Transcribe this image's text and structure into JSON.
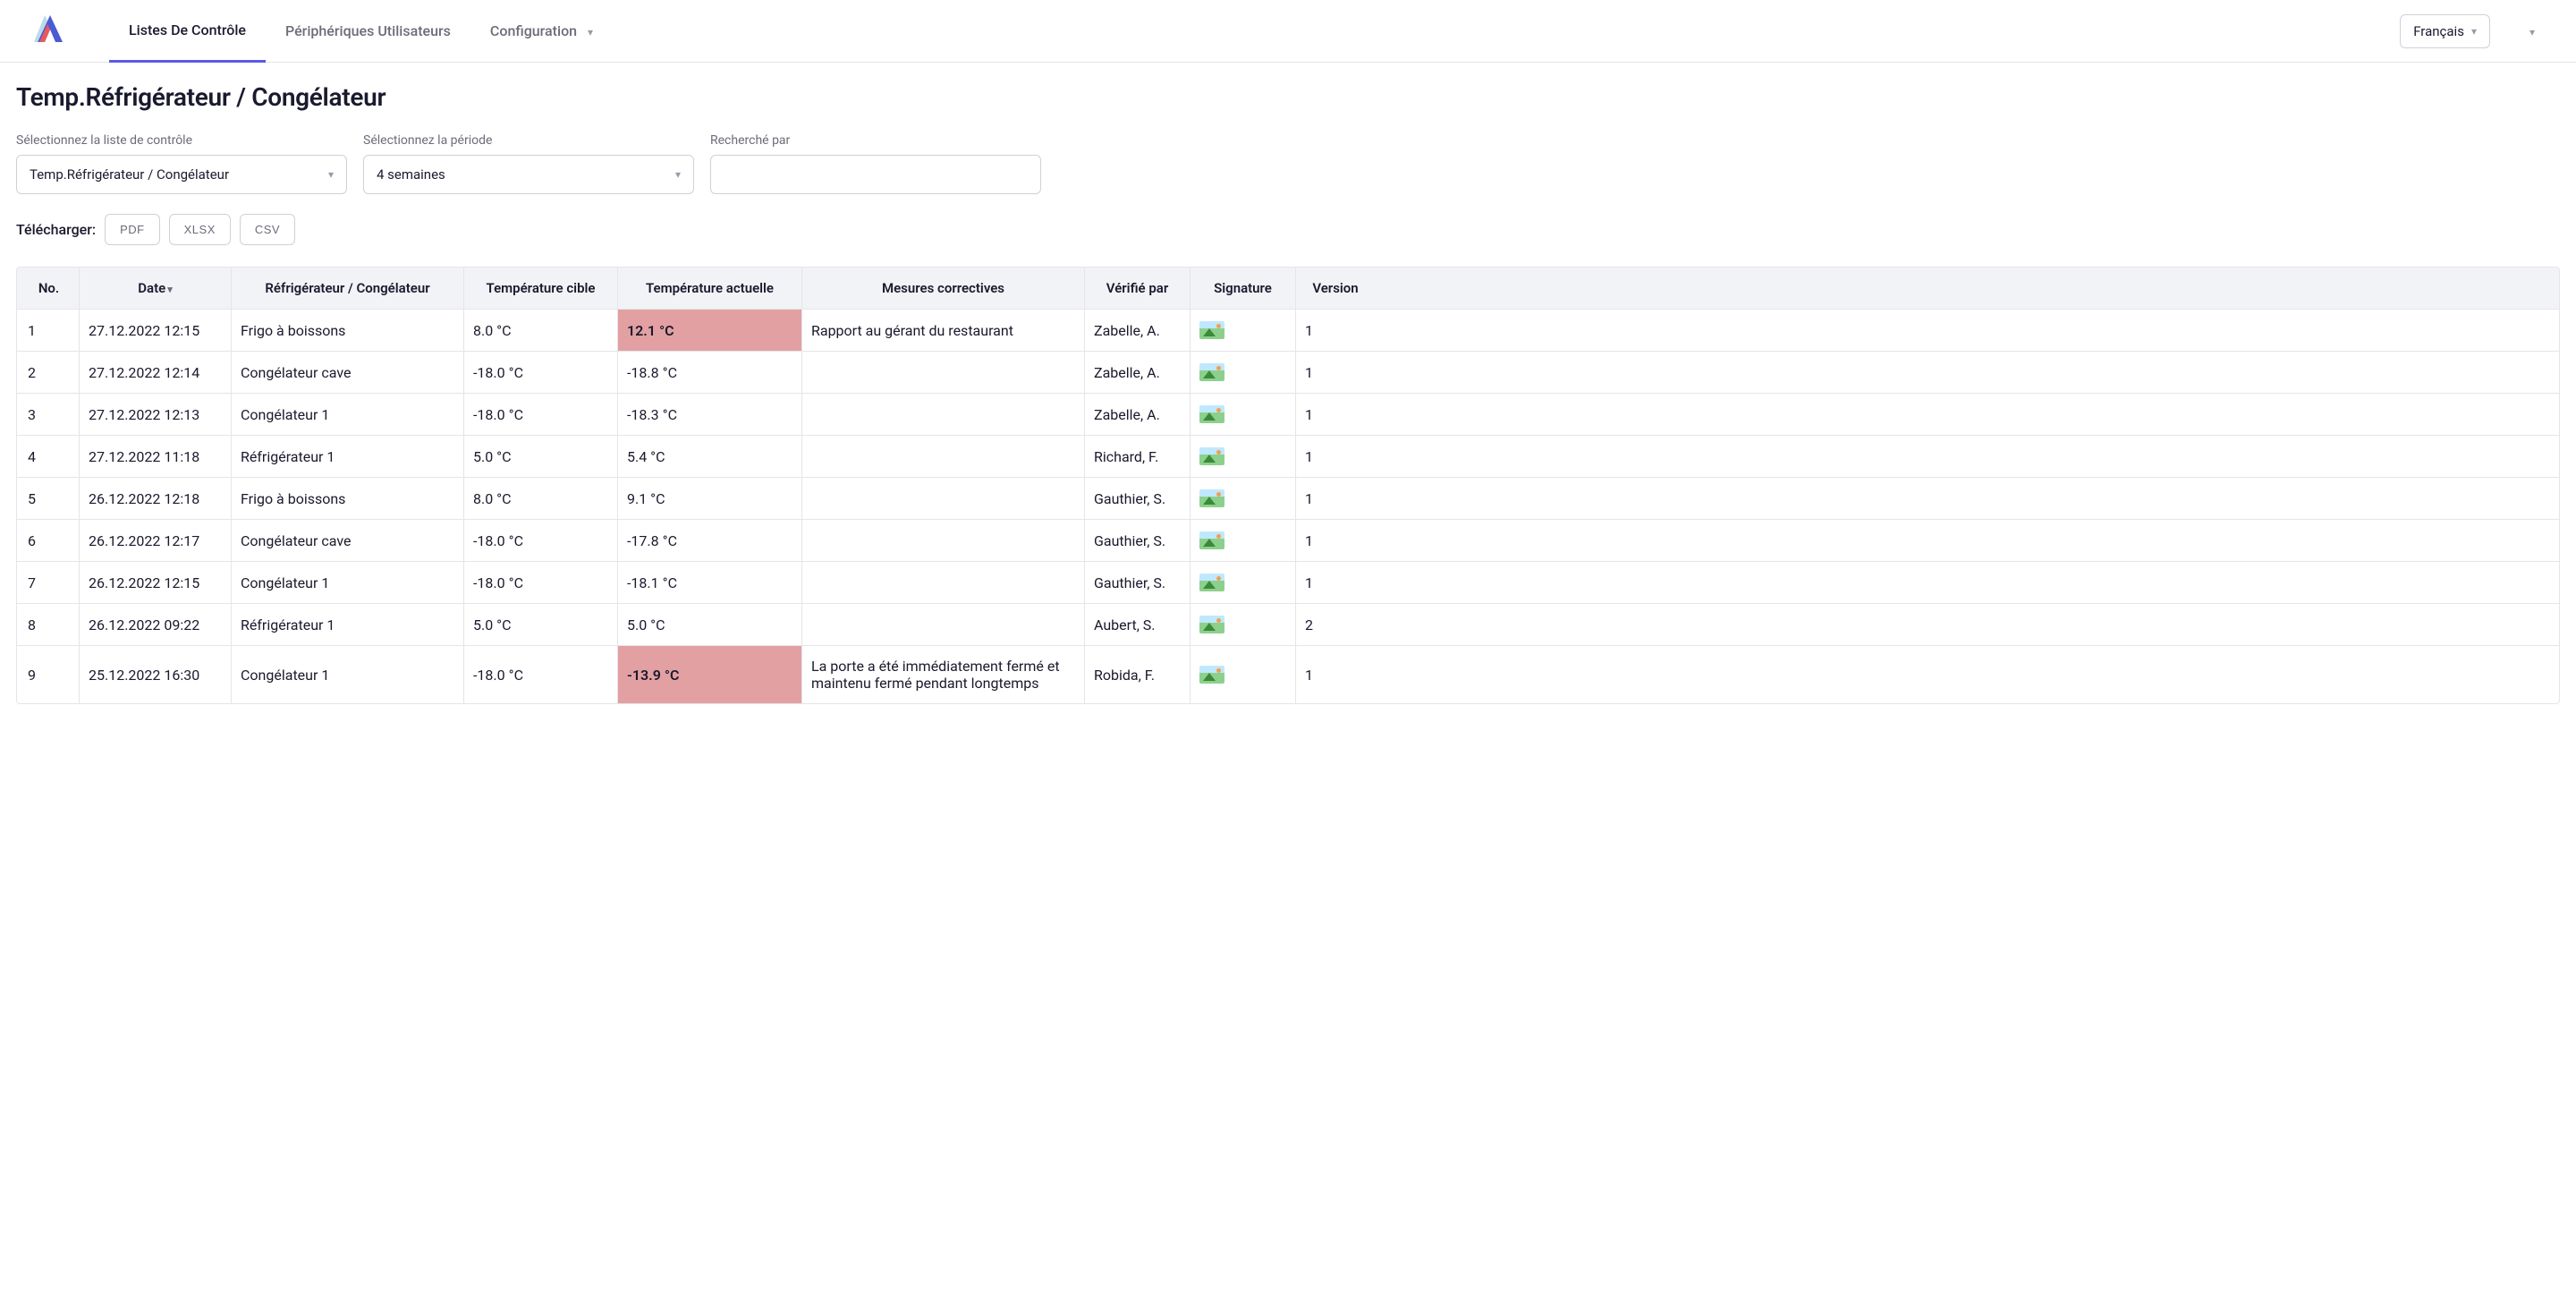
{
  "nav": {
    "tab1": "Listes De Contrôle",
    "tab2": "Périphériques Utilisateurs",
    "tab3": "Configuration"
  },
  "language_label": "Français",
  "page_title": "Temp.Réfrigérateur / Congélateur",
  "filters": {
    "checklist_label": "Sélectionnez la liste de contrôle",
    "checklist_value": "Temp.Réfrigérateur / Congélateur",
    "period_label": "Sélectionnez la période",
    "period_value": "4 semaines",
    "search_label": "Recherché par",
    "search_value": ""
  },
  "download": {
    "label": "Télécharger:",
    "pdf": "PDF",
    "xlsx": "XLSX",
    "csv": "CSV"
  },
  "table": {
    "headers": {
      "no": "No.",
      "date": "Date",
      "device": "Réfrigérateur / Congélateur",
      "target": "Température cible",
      "actual": "Température actuelle",
      "corrective": "Mesures correctives",
      "verified": "Vérifié par",
      "signature": "Signature",
      "version": "Version"
    },
    "rows": [
      {
        "no": "1",
        "date": "27.12.2022 12:15",
        "device": "Frigo à boissons",
        "target": "8.0 °C",
        "actual": "12.1 °C",
        "alert": true,
        "corrective": "Rapport au gérant du restaurant",
        "verified": "Zabelle, A.",
        "version": "1"
      },
      {
        "no": "2",
        "date": "27.12.2022 12:14",
        "device": "Congélateur cave",
        "target": "-18.0 °C",
        "actual": "-18.8 °C",
        "alert": false,
        "corrective": "",
        "verified": "Zabelle, A.",
        "version": "1"
      },
      {
        "no": "3",
        "date": "27.12.2022 12:13",
        "device": "Congélateur 1",
        "target": "-18.0 °C",
        "actual": "-18.3 °C",
        "alert": false,
        "corrective": "",
        "verified": "Zabelle, A.",
        "version": "1"
      },
      {
        "no": "4",
        "date": "27.12.2022 11:18",
        "device": "Réfrigérateur 1",
        "target": "5.0 °C",
        "actual": "5.4 °C",
        "alert": false,
        "corrective": "",
        "verified": "Richard, F.",
        "version": "1"
      },
      {
        "no": "5",
        "date": "26.12.2022 12:18",
        "device": "Frigo à boissons",
        "target": "8.0 °C",
        "actual": "9.1 °C",
        "alert": false,
        "corrective": "",
        "verified": "Gauthier, S.",
        "version": "1"
      },
      {
        "no": "6",
        "date": "26.12.2022 12:17",
        "device": "Congélateur cave",
        "target": "-18.0 °C",
        "actual": "-17.8 °C",
        "alert": false,
        "corrective": "",
        "verified": "Gauthier, S.",
        "version": "1"
      },
      {
        "no": "7",
        "date": "26.12.2022 12:15",
        "device": "Congélateur 1",
        "target": "-18.0 °C",
        "actual": "-18.1 °C",
        "alert": false,
        "corrective": "",
        "verified": "Gauthier, S.",
        "version": "1"
      },
      {
        "no": "8",
        "date": "26.12.2022 09:22",
        "device": "Réfrigérateur 1",
        "target": "5.0 °C",
        "actual": "5.0 °C",
        "alert": false,
        "corrective": "",
        "verified": "Aubert, S.",
        "version": "2"
      },
      {
        "no": "9",
        "date": "25.12.2022 16:30",
        "device": "Congélateur 1",
        "target": "-18.0 °C",
        "actual": "-13.9 °C",
        "alert": true,
        "corrective": "La porte a été immédiatement fermé et maintenu fermé pendant longtemps",
        "verified": "Robida, F.",
        "version": "1"
      }
    ]
  }
}
